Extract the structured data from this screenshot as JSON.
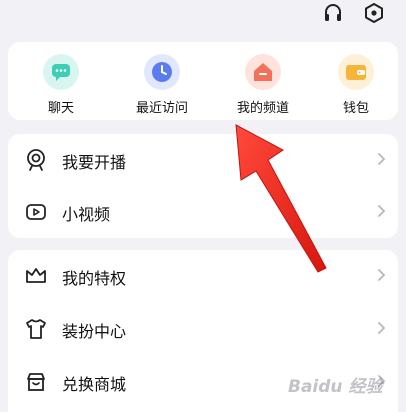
{
  "topbar": {
    "icons": [
      "headset-icon",
      "settings-hexagon-icon"
    ]
  },
  "quick_actions": [
    {
      "label": "聊天",
      "icon": "chat-icon",
      "color": "#3ccfb6"
    },
    {
      "label": "最近访问",
      "icon": "clock-icon",
      "color": "#5b7bf0"
    },
    {
      "label": "我的频道",
      "icon": "channel-home-icon",
      "color": "#f2715a"
    },
    {
      "label": "钱包",
      "icon": "wallet-icon",
      "color": "#f5b53a"
    }
  ],
  "group1": [
    {
      "label": "我要开播",
      "icon": "live-broadcast-icon"
    },
    {
      "label": "小视频",
      "icon": "video-icon"
    }
  ],
  "group2": [
    {
      "label": "我的特权",
      "icon": "crown-icon"
    },
    {
      "label": "装扮中心",
      "icon": "shirt-icon"
    },
    {
      "label": "兑换商城",
      "icon": "store-icon"
    }
  ],
  "watermark": {
    "text": "Baidu 经验"
  },
  "colors": {
    "background": "#f2f2f6",
    "card": "#ffffff",
    "annotation_arrow": "#e8231d"
  }
}
